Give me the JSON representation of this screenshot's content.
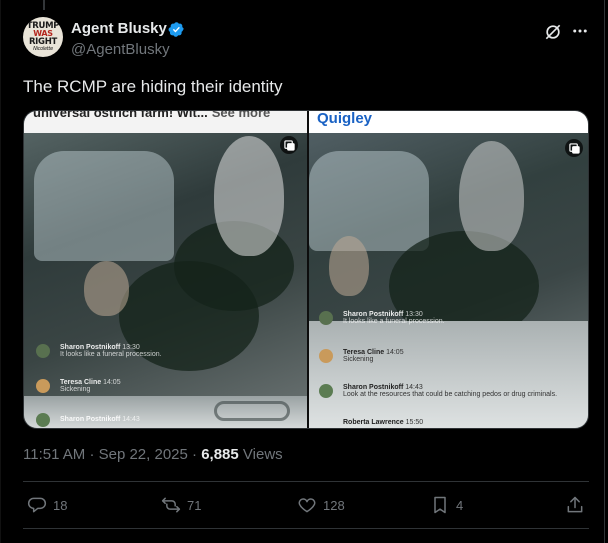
{
  "author": {
    "display_name": "Agent Blusky",
    "handle": "@AgentBlusky",
    "avatar_lines": [
      "TRUMP",
      "WAS",
      "RIGHT",
      "Nicolette"
    ]
  },
  "tweet": {
    "text": "The RCMP are hiding their identity"
  },
  "media": {
    "left_caption": "universal ostrich farm! Wit...",
    "left_see_more": "See more",
    "right_caption": "Quigley",
    "left_comments": [
      {
        "name": "Sharon Postnikoff",
        "time": "13:30",
        "text": "It looks like a funeral procession."
      },
      {
        "name": "Teresa Cline",
        "time": "14:05",
        "text": "Sickening"
      },
      {
        "name": "Sharon Postnikoff",
        "time": "14:43",
        "text": ""
      }
    ],
    "right_comments": [
      {
        "name": "Sharon Postnikoff",
        "time": "13:30",
        "text": "It looks like a funeral procession."
      },
      {
        "name": "Teresa Cline",
        "time": "14:05",
        "text": "Sickening"
      },
      {
        "name": "Sharon Postnikoff",
        "time": "14:43",
        "text": "Look at the resources that could be catching pedos or drug criminals."
      },
      {
        "name": "Roberta Lawrence",
        "time": "15:50",
        "text": ""
      }
    ]
  },
  "meta": {
    "time": "11:51 AM",
    "dot": "·",
    "date": "Sep 22, 2025",
    "views_count": "6,885",
    "views_label": "Views"
  },
  "actions": {
    "replies": "18",
    "reposts": "71",
    "likes": "128",
    "bookmarks": "4"
  },
  "colors": {
    "background": "#000000",
    "text_primary": "#e7e9ea",
    "text_secondary": "#71767b",
    "verified": "#1d9bf0",
    "border": "#2f3336"
  },
  "icons": [
    "verified-badge-icon",
    "grok-icon",
    "more-icon",
    "pip-icon",
    "reply-icon",
    "repost-icon",
    "like-icon",
    "bookmark-icon",
    "share-icon"
  ]
}
